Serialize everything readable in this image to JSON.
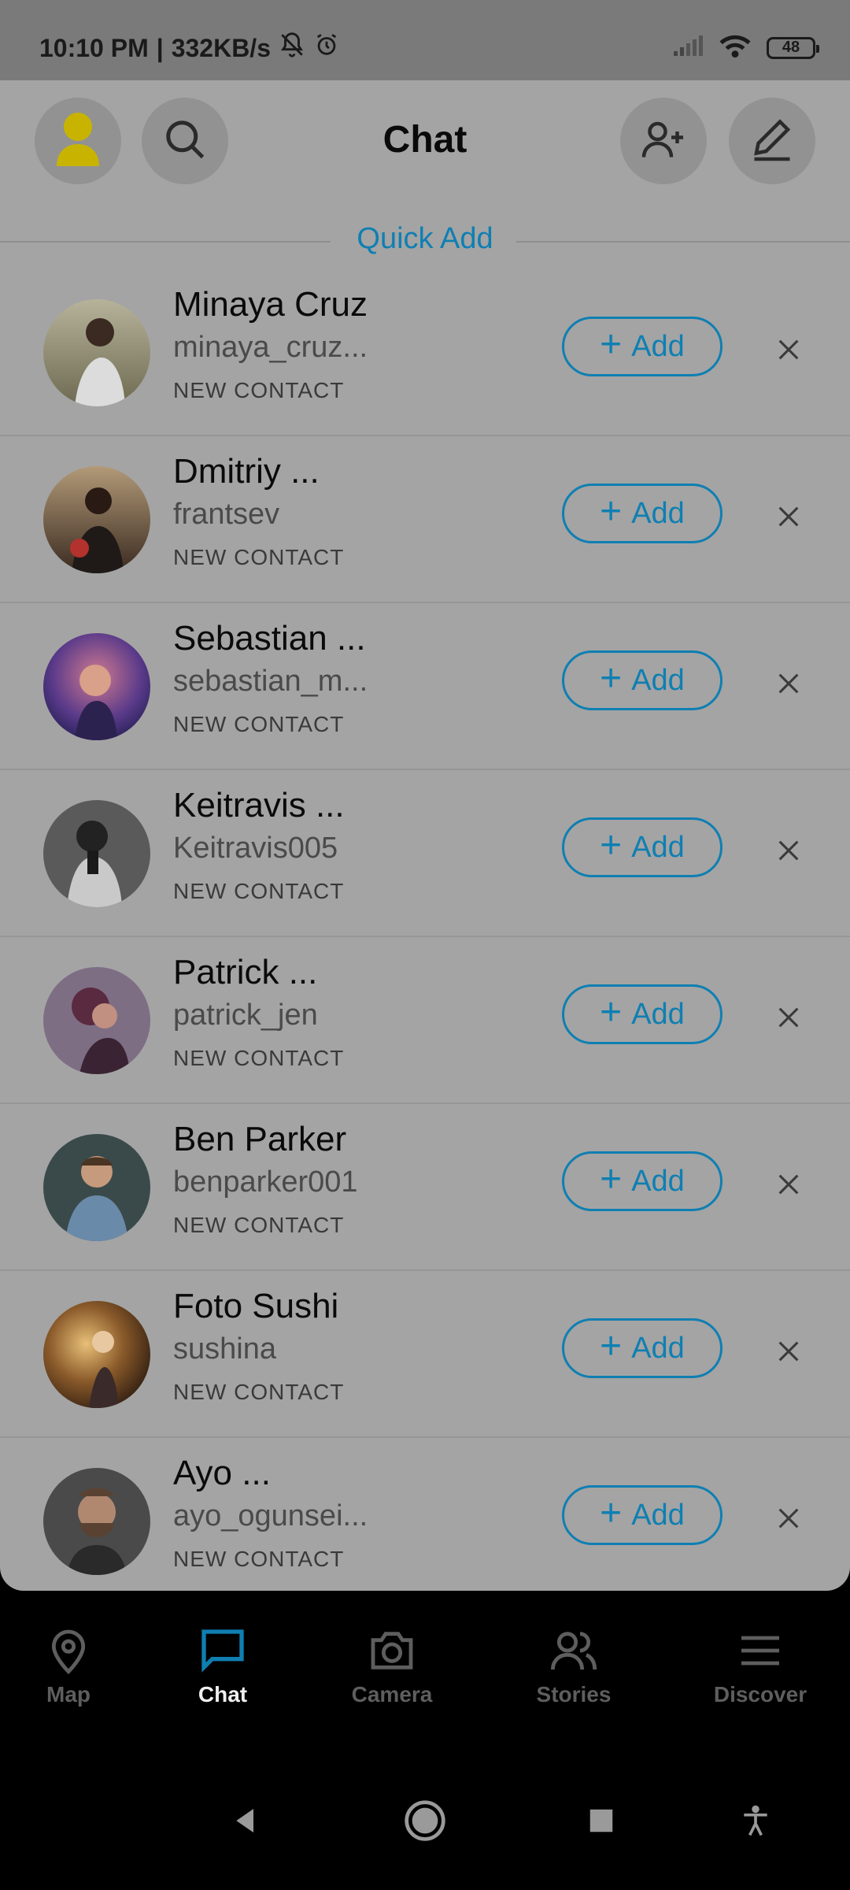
{
  "status": {
    "time": "10:10 PM",
    "speed": "332KB/s",
    "battery": "48"
  },
  "header": {
    "title": "Chat"
  },
  "quick_add": {
    "section_label": "Quick Add",
    "add_label": "Add",
    "contacts": [
      {
        "name": "Minaya Cruz",
        "username": "minaya_cruz...",
        "sub": "NEW CONTACT"
      },
      {
        "name": "Dmitriy ...",
        "username": "frantsev",
        "sub": "NEW CONTACT"
      },
      {
        "name": "Sebastian ...",
        "username": "sebastian_m...",
        "sub": "NEW CONTACT"
      },
      {
        "name": "Keitravis ...",
        "username": "Keitravis005",
        "sub": "NEW CONTACT"
      },
      {
        "name": "Patrick ...",
        "username": "patrick_jen",
        "sub": "NEW CONTACT"
      },
      {
        "name": "Ben Parker",
        "username": "benparker001",
        "sub": "NEW CONTACT"
      },
      {
        "name": "Foto Sushi",
        "username": "sushina",
        "sub": "NEW CONTACT"
      },
      {
        "name": "Ayo ...",
        "username": "ayo_ogunsei...",
        "sub": "NEW CONTACT"
      }
    ]
  },
  "nav": {
    "items": [
      {
        "label": "Map",
        "icon": "map-pin-icon"
      },
      {
        "label": "Chat",
        "icon": "chat-icon"
      },
      {
        "label": "Camera",
        "icon": "camera-icon"
      },
      {
        "label": "Stories",
        "icon": "stories-icon"
      },
      {
        "label": "Discover",
        "icon": "menu-icon"
      }
    ],
    "active": "Chat"
  },
  "colors": {
    "accent": "#0f7fb2",
    "panel": "#a4a4a4",
    "avatar_yellow": "#c8b400"
  }
}
